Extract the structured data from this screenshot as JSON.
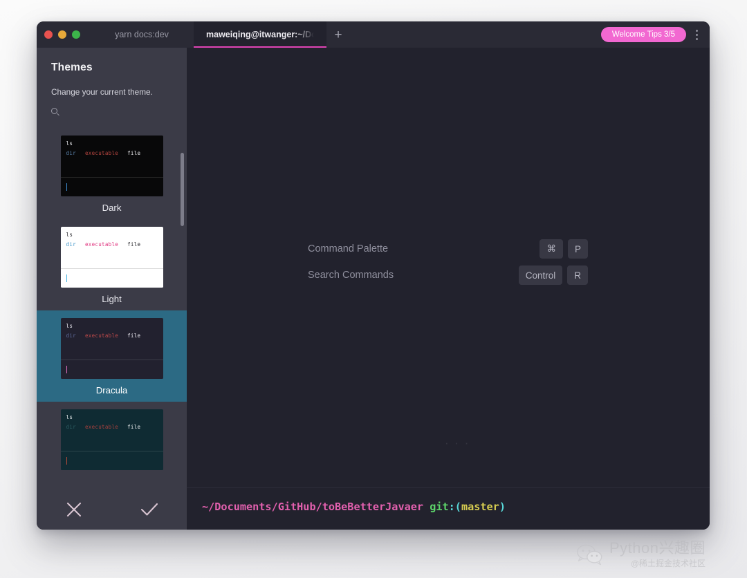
{
  "window": {
    "traffic_lights": [
      {
        "name": "close",
        "color": "#e9524f"
      },
      {
        "name": "minimize",
        "color": "#e8a93a"
      },
      {
        "name": "zoom",
        "color": "#3cb44a"
      }
    ],
    "tabs": [
      {
        "label": "yarn docs:dev",
        "active": false
      },
      {
        "label": "maweiqing@itwanger:~/Docum",
        "active": true
      }
    ],
    "new_tab_label": "+",
    "welcome_badge": "Welcome Tips 3/5",
    "accent_color": "#e044b6",
    "badge_color": "#f268d1",
    "menu_icon": "kebab-menu-icon"
  },
  "sidebar": {
    "title": "Themes",
    "description": "Change your current theme.",
    "search_icon": "search-icon",
    "selected_theme": "Dracula",
    "themes": [
      {
        "name": "Dark",
        "selected": false,
        "bg": "#080809",
        "prompt_bg": "#080809",
        "cmd": "ls",
        "cmd_color": "#e8e8ec",
        "dir": "dir",
        "dir_color": "#5a7fa8",
        "executable": "executable",
        "executable_color": "#b6453f",
        "file": "file",
        "file_color": "#e8e8ec",
        "caret_color": "#3f8fd6"
      },
      {
        "name": "Light",
        "selected": false,
        "bg": "#ffffff",
        "prompt_bg": "#ffffff",
        "cmd": "ls",
        "cmd_color": "#26262b",
        "dir": "dir",
        "dir_color": "#3f95c9",
        "executable": "executable",
        "executable_color": "#e0347f",
        "file": "file",
        "file_color": "#26262b",
        "caret_color": "#3fb0e0"
      },
      {
        "name": "Dracula",
        "selected": true,
        "bg": "#22212f",
        "prompt_bg": "#22212f",
        "cmd": "ls",
        "cmd_color": "#eceaf2",
        "dir": "dir",
        "dir_color": "#5f6d9e",
        "executable": "executable",
        "executable_color": "#c04a4a",
        "file": "file",
        "file_color": "#eceaf2",
        "caret_color": "#e06fbe"
      },
      {
        "name": "",
        "selected": false,
        "bg": "#0f2b33",
        "prompt_bg": "#0f2b33",
        "cmd": "ls",
        "cmd_color": "#e8eced",
        "dir": "dir",
        "dir_color": "#2c5d62",
        "executable": "executable",
        "executable_color": "#a8403d",
        "file": "file",
        "file_color": "#e8eced",
        "caret_color": "#b54b3a"
      }
    ],
    "actions": [
      {
        "name": "cancel",
        "icon": "close-x-icon"
      },
      {
        "name": "confirm",
        "icon": "check-icon"
      }
    ]
  },
  "terminal": {
    "shortcuts": [
      {
        "label": "Command Palette",
        "keys": [
          "⌘",
          "P"
        ]
      },
      {
        "label": "Search Commands",
        "keys": [
          "Control",
          "R"
        ]
      }
    ],
    "ellipsis": "· · ·",
    "prompt": {
      "path": "~/Documents/GitHub/toBeBetterJavaer",
      "git_keyword": "git",
      "colon": ":",
      "open_paren": "(",
      "branch": "master",
      "close_paren": ")",
      "path_color": "#e260ae",
      "git_color": "#5dd46a",
      "paren_color": "#58d9d9",
      "branch_color": "#d6cc50"
    }
  },
  "watermark": {
    "logo": "wechat-icon",
    "title": "Python兴趣圈",
    "subtitle": "@稀土掘金技术社区"
  }
}
